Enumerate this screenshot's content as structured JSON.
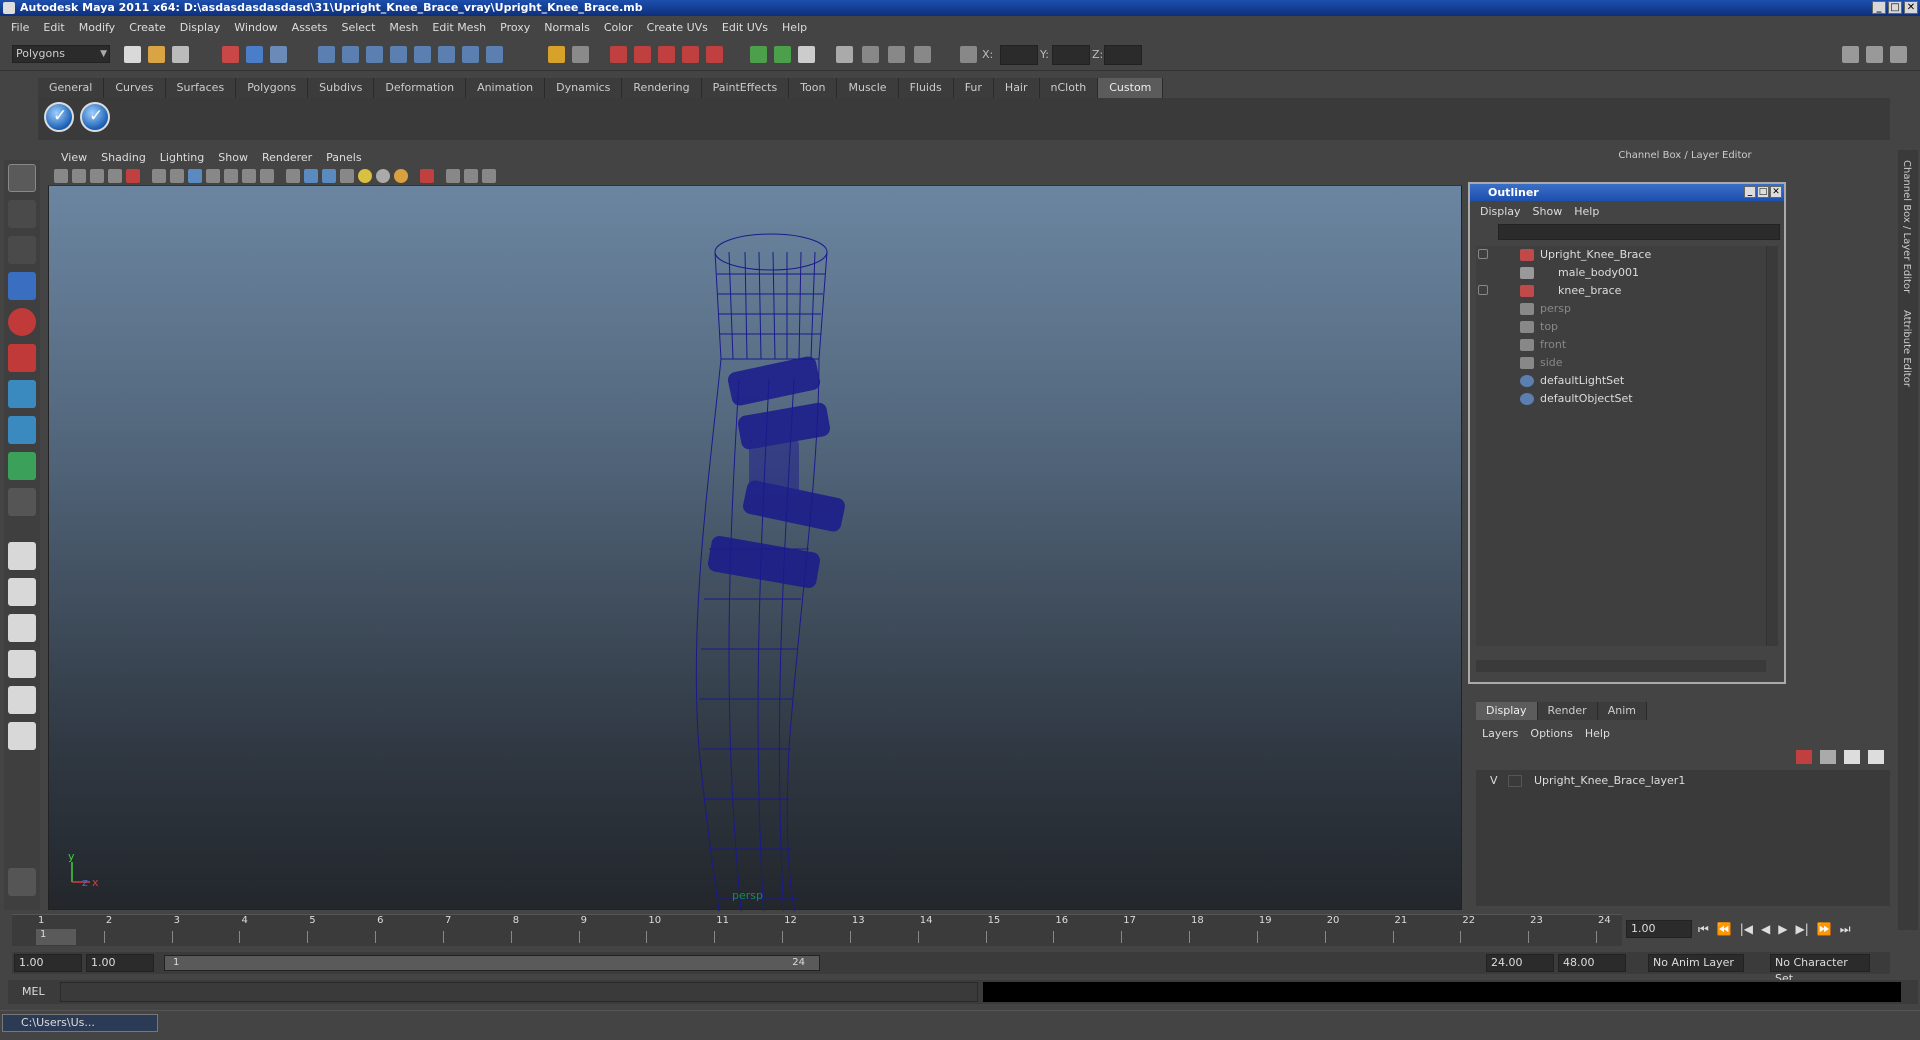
{
  "window": {
    "title": "Autodesk Maya 2011 x64: D:\\asdasdasdasdasd\\31\\Upright_Knee_Brace_vray\\Upright_Knee_Brace.mb",
    "controls": [
      "_",
      "□",
      "✕"
    ]
  },
  "menubar": [
    "File",
    "Edit",
    "Modify",
    "Create",
    "Display",
    "Window",
    "Assets",
    "Select",
    "Mesh",
    "Edit Mesh",
    "Proxy",
    "Normals",
    "Color",
    "Create UVs",
    "Edit UVs",
    "Help"
  ],
  "statusline": {
    "mode": "Polygons",
    "x_label": "X:",
    "y_label": "Y:",
    "z_label": "Z:"
  },
  "shelf": {
    "tabs": [
      "General",
      "Curves",
      "Surfaces",
      "Polygons",
      "Subdivs",
      "Deformation",
      "Animation",
      "Dynamics",
      "Rendering",
      "PaintEffects",
      "Toon",
      "Muscle",
      "Fluids",
      "Fur",
      "Hair",
      "nCloth",
      "Custom"
    ],
    "active_tab": "Custom"
  },
  "viewport": {
    "menu": [
      "View",
      "Shading",
      "Lighting",
      "Show",
      "Renderer",
      "Panels"
    ],
    "camera_label": "persp",
    "axis_y": "y",
    "axis_x": "x",
    "axis_z": "z",
    "wire_color": "#1a1a8c"
  },
  "right_panel": {
    "header": "Channel Box / Layer Editor",
    "side_tabs": [
      "Channel Box / Layer Editor",
      "Attribute Editor"
    ]
  },
  "outliner": {
    "title": "Outliner",
    "menu": [
      "Display",
      "Show",
      "Help"
    ],
    "items": [
      {
        "label": "Upright_Knee_Brace",
        "style": "bright"
      },
      {
        "label": "male_body001",
        "style": "bright"
      },
      {
        "label": "knee_brace",
        "style": "bright"
      },
      {
        "label": "persp",
        "style": "dim"
      },
      {
        "label": "top",
        "style": "dim"
      },
      {
        "label": "front",
        "style": "dim"
      },
      {
        "label": "side",
        "style": "dim"
      },
      {
        "label": "defaultLightSet",
        "style": "bright"
      },
      {
        "label": "defaultObjectSet",
        "style": "bright"
      }
    ]
  },
  "layer_editor": {
    "tabs": [
      "Display",
      "Render",
      "Anim"
    ],
    "active_tab": "Display",
    "menu": [
      "Layers",
      "Options",
      "Help"
    ],
    "layer_visible": "V",
    "layer_name": "Upright_Knee_Brace_layer1"
  },
  "timeline": {
    "ticks": [
      "1",
      "2",
      "3",
      "4",
      "5",
      "6",
      "7",
      "8",
      "9",
      "10",
      "11",
      "12",
      "13",
      "14",
      "15",
      "16",
      "17",
      "18",
      "19",
      "20",
      "21",
      "22",
      "23",
      "24"
    ],
    "current_frame_marker": "1",
    "current_time": "1.00",
    "play_controls": [
      "⏮",
      "⏪",
      "|◀",
      "◀",
      "▶",
      "▶|",
      "⏩",
      "⏭"
    ]
  },
  "range": {
    "start": "1.00",
    "start_inner": "1.00",
    "slider_start": "1",
    "slider_end": "24",
    "end_inner": "24.00",
    "end": "48.00",
    "anim_layer": "No Anim Layer",
    "character_set": "No Character Set"
  },
  "commandline": {
    "label": "MEL"
  },
  "taskbar": {
    "item": "C:\\Users\\Us..."
  }
}
